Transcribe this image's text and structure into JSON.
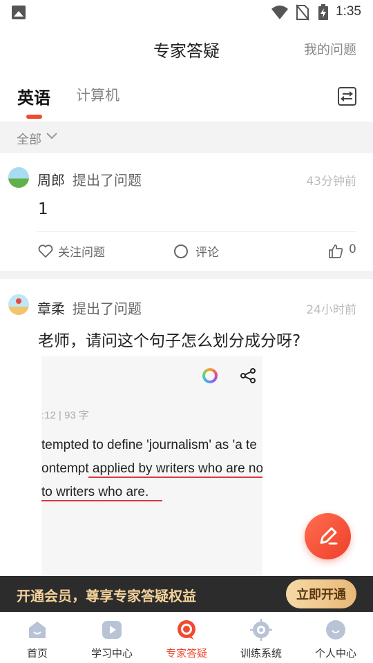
{
  "status_bar": {
    "time": "1:35"
  },
  "header": {
    "title": "专家答疑",
    "right_link": "我的问题"
  },
  "tabs": [
    {
      "label": "英语",
      "active": true
    },
    {
      "label": "计算机",
      "active": false
    }
  ],
  "filter": {
    "label": "全部"
  },
  "questions": [
    {
      "user": "周郎",
      "action": "提出了问题",
      "time": "43分钟前",
      "text": "1",
      "follow_label": "关注问题",
      "comment_label": "评论",
      "likes": "0"
    },
    {
      "user": "章柔",
      "action": "提出了问题",
      "time": "24小时前",
      "text": "老师，请问这个句子怎么划分成分呀?",
      "image": {
        "meta": ":12  |  93 字",
        "lines": [
          "tempted to define 'journalism' as 'a te",
          "ontempt applied by writers who are no",
          "to writers who are."
        ]
      }
    }
  ],
  "banner": {
    "text": "开通会员，尊享专家答疑权益",
    "button": "立即开通"
  },
  "bottom_nav": [
    {
      "label": "首页",
      "icon": "home-icon",
      "active": false
    },
    {
      "label": "学习中心",
      "icon": "play-icon",
      "active": false
    },
    {
      "label": "专家答疑",
      "icon": "expert-qa-icon",
      "active": true
    },
    {
      "label": "训练系统",
      "icon": "target-icon",
      "active": false
    },
    {
      "label": "个人中心",
      "icon": "profile-icon",
      "active": false
    }
  ],
  "colors": {
    "accent": "#f04a31",
    "banner_bg": "#2c2c2c",
    "banner_text": "#f3d19a",
    "nav_inactive": "#b8c3d6"
  }
}
